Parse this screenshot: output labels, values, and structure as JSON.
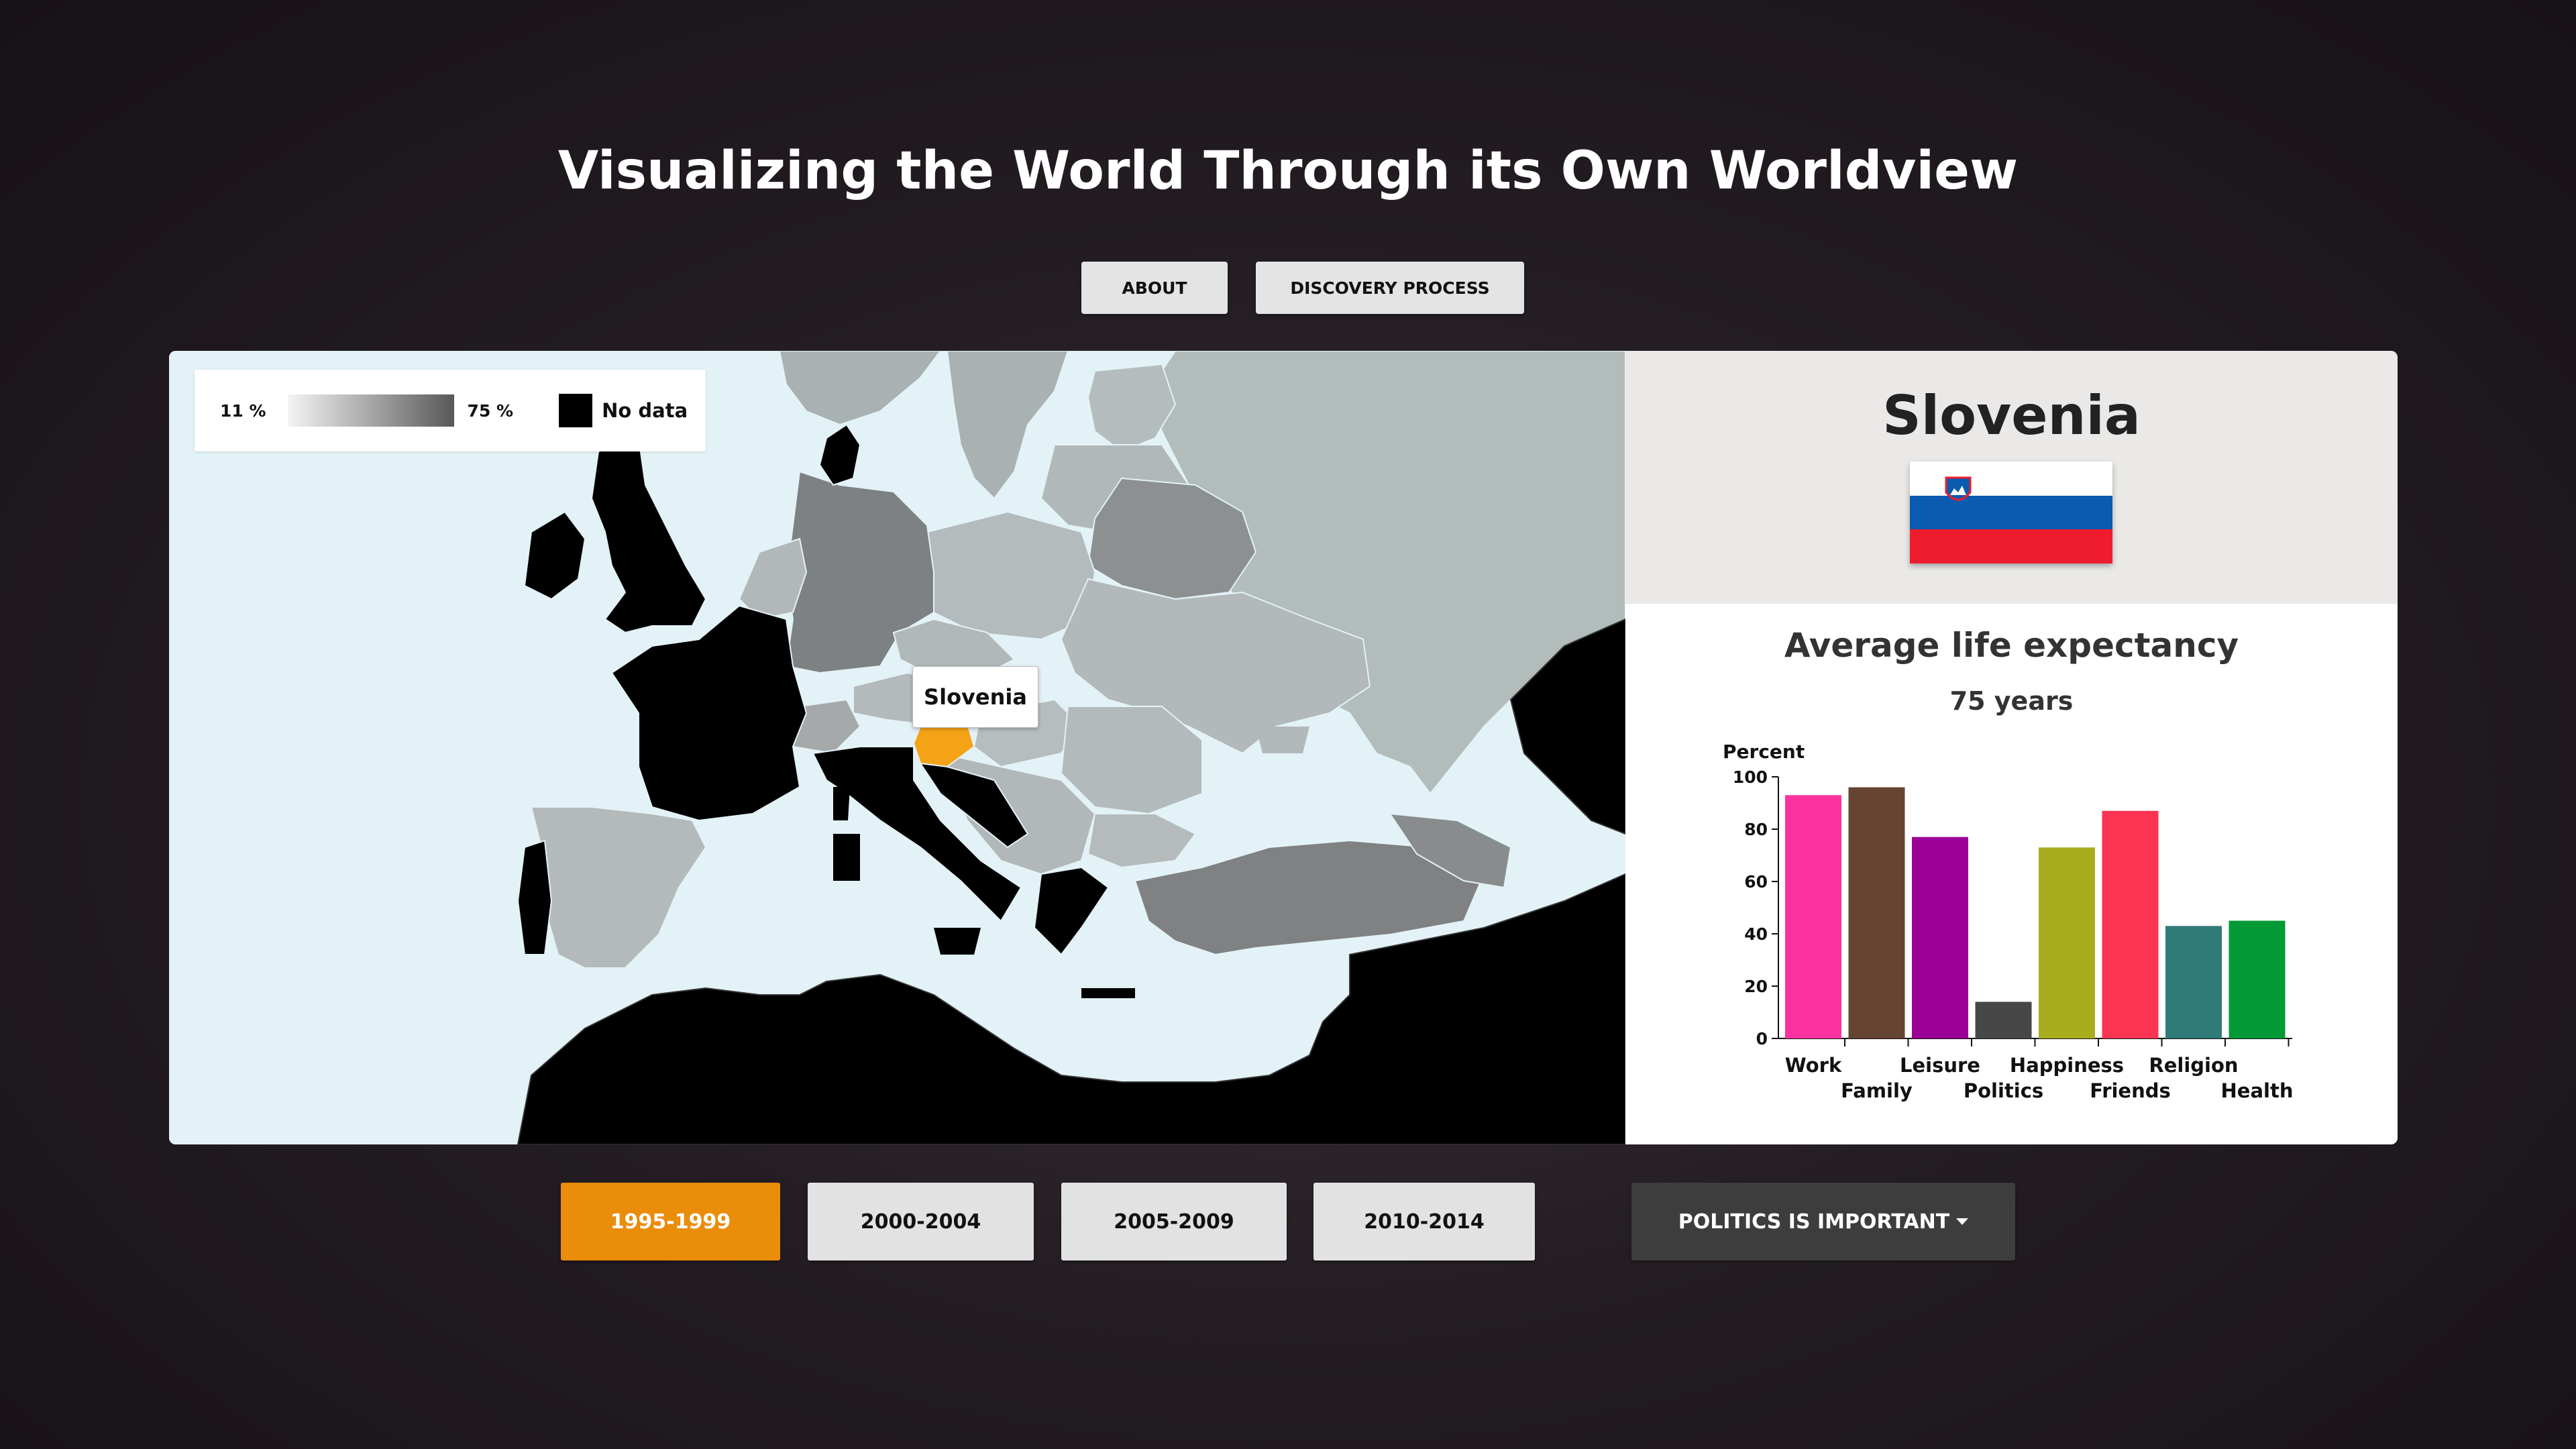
{
  "title": "Visualizing the World Through its Own Worldview",
  "nav": {
    "about_label": "ABOUT",
    "discovery_label": "DISCOVERY PROCESS"
  },
  "legend": {
    "min_label": "11 %",
    "max_label": "75 %",
    "no_data_label": "No data",
    "gradient_from": "#f4f4f4",
    "gradient_to": "#585858",
    "no_data_color": "#000000"
  },
  "map": {
    "tooltip": "Slovenia",
    "highlight_color": "#f5a316",
    "sea_color": "#e3f2f7"
  },
  "country": {
    "name": "Slovenia",
    "flag_colors": [
      "#ffffff",
      "#0b5bb0",
      "#ee1c2e"
    ],
    "metric_title": "Average life expectancy",
    "metric_value": "75 years"
  },
  "years": {
    "options": [
      "1995-1999",
      "2000-2004",
      "2005-2009",
      "2010-2014"
    ],
    "selected": "1995-1999"
  },
  "dropdown": {
    "label": "POLITICS IS IMPORTANT",
    "icon": "caret-down-icon"
  },
  "chart_data": {
    "type": "bar",
    "title": "",
    "ylabel": "Percent",
    "xlabel": "",
    "ylim": [
      0,
      100
    ],
    "yticks": [
      0,
      20,
      40,
      60,
      80,
      100
    ],
    "categories": [
      "Work",
      "Family",
      "Leisure",
      "Politics",
      "Happiness",
      "Friends",
      "Religion",
      "Health"
    ],
    "values": [
      93,
      96,
      77,
      14,
      73,
      87,
      43,
      45
    ],
    "colors": [
      "#fc329e",
      "#654432",
      "#9b0096",
      "#474747",
      "#a8ad1d",
      "#fb3452",
      "#307a77",
      "#029a37"
    ]
  }
}
